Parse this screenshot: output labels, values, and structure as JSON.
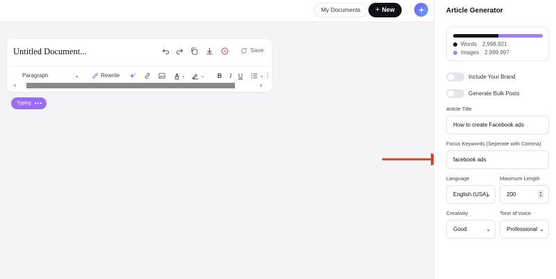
{
  "topbar": {
    "my_documents": "My Documents",
    "new_label": "New",
    "new_icon": "plus-icon",
    "magic_icon": "sparkle-icon"
  },
  "editor": {
    "document_title": "Untitled Document...",
    "save_label": "Save",
    "paragraph_select": "Paragraph",
    "rewrite_label": "Rewrite",
    "toolbar_icons": [
      "undo-icon",
      "redo-icon",
      "copy-icon",
      "download-icon",
      "delete-icon",
      "refresh-icon",
      "ai-sparkle-icon",
      "link-icon",
      "image-icon",
      "text-color-icon",
      "highlight-icon",
      "bold-icon",
      "italic-icon",
      "underline-icon",
      "list-icon",
      "more-icon"
    ]
  },
  "status": {
    "typing_label": "Typing",
    "dots": "•••"
  },
  "panel": {
    "title": "Article Generator",
    "usage": {
      "words_label": "Words",
      "words_value": "2,998,921",
      "images_label": "Images",
      "images_value": "2,999,997",
      "words_fraction": 0.5,
      "words_color": "#16161c",
      "images_color": "#a47cf8"
    },
    "include_brand": "Include Your Brand",
    "bulk_posts": "Generate Bulk Posts",
    "article_title_label": "Article Title",
    "article_title_value": "How to create Facebook ads",
    "focus_keywords_label": "Focus Keywords (Seperate with Comma)",
    "focus_keywords_value": "facebook ads",
    "language_label": "Language",
    "language_value": "English (USA)",
    "max_length_label": "Maximum Length",
    "max_length_value": "200",
    "creativity_label": "Creativity",
    "creativity_value": "Good",
    "tone_label": "Tone of Voice",
    "tone_value": "Professional"
  },
  "colors": {
    "accent": "#9a6cf5",
    "arrow": "#d0432b",
    "dark": "#101014"
  }
}
